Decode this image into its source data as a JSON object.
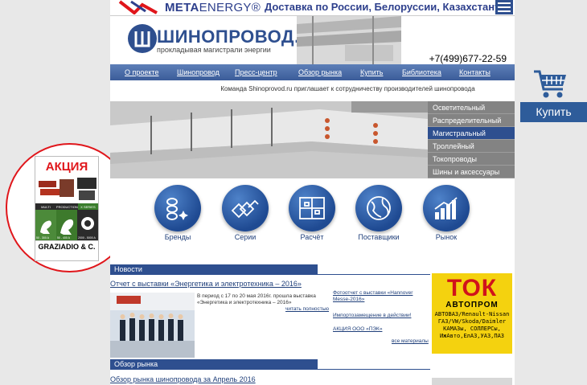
{
  "top_banner": {
    "brand_meta": "META",
    "brand_energy": "ENERGY®",
    "delivery": "Доставка по России, Белоруссии, Казахстану"
  },
  "header": {
    "logo_text": "ШИНОПРОВОД.РУ",
    "tagline": "прокладывая магистрали энергии",
    "phone": "+7(499)677-22-59"
  },
  "nav": {
    "items": [
      "О проекте",
      "Шинопровод",
      "Пресс-центр",
      "Обзор рынка",
      "Купить",
      "Библиотека",
      "Контакты"
    ]
  },
  "partner_line": "Команда Shinoprovod.ru приглашает к сотрудничеству производителей шинопровода",
  "categories": {
    "items": [
      "Осветительный",
      "Распределительный",
      "Магистральный",
      "Троллейный",
      "Токопроводы",
      "Шины и аксессуары"
    ],
    "active_index": 2
  },
  "icons": {
    "items": [
      {
        "label": "Бренды",
        "icon": "brands-icon"
      },
      {
        "label": "Серии",
        "icon": "series-icon"
      },
      {
        "label": "Расчёт",
        "icon": "calculation-icon"
      },
      {
        "label": "Поставщики",
        "icon": "globe-icon"
      },
      {
        "label": "Рынок",
        "icon": "bar-chart-icon"
      }
    ]
  },
  "news": {
    "section_title": "Новости",
    "headline": "Отчет с выставки «Энергетика и электротехника – 2016»",
    "summary": "В период с 17 по 20 мая 2016г. прошла выставка «Энергетика и электротехника – 2016»",
    "read_more": "читать полностью",
    "side": [
      "Фотоотчет с выставки «Hannover Messe-2016»",
      "Импортозамещение в действии!",
      "АКЦИЯ ООО «ПЭК»"
    ],
    "all_materials": "все материалы"
  },
  "review": {
    "section_title": "Обзор рынка",
    "headline": "Обзор рынка шинопровода за Апрель 2016"
  },
  "tok_ad": {
    "title": "ТОК",
    "subtitle": "АВТОПРОМ",
    "lines": [
      "АВТОВАЗ/Renault-Nissan",
      "ГАЗ/VW/Skoda/Daimler",
      "КАМАЗы, СОЛЛЕРСы,",
      "ИжАвто,ЕлАЗ,УАЗ,ПАЗ"
    ]
  },
  "promo": {
    "title": "АКЦИЯ",
    "series": [
      "MULTI CONDUCTOR",
      "PRODUCTION",
      "X SERIES"
    ],
    "ratings": [
      "50 - 300 A",
      "50 - 400 A",
      "2000 - 5000 A"
    ],
    "brand": "GRAZIADIO & C."
  },
  "buy": {
    "label": "Купить"
  },
  "colors": {
    "brand_blue": "#2e4f8f",
    "accent_red": "#e0161b",
    "ad_yellow": "#f4d20f"
  }
}
